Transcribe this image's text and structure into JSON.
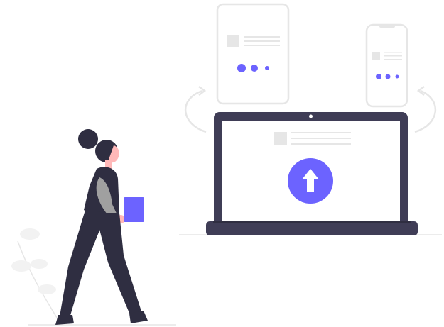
{
  "illustration": {
    "colors": {
      "accent": "#6c63ff",
      "laptop_dark": "#3f3d56",
      "figure_dark": "#2f2e41",
      "device_outline": "#e6e6e6",
      "placeholder_line": "#e6e6e6",
      "placeholder_block": "#e6e6e6",
      "skin": "#ffb8b8",
      "sleeve": "#a0a0a0",
      "leaf": "#f2f2f2",
      "ground": "#e6e6e6",
      "arrow": "#ffffff"
    },
    "devices": [
      "tablet",
      "phone",
      "laptop"
    ],
    "icons": [
      "upload-arrow-icon",
      "sync-arrow-left-icon",
      "sync-arrow-right-icon"
    ]
  }
}
